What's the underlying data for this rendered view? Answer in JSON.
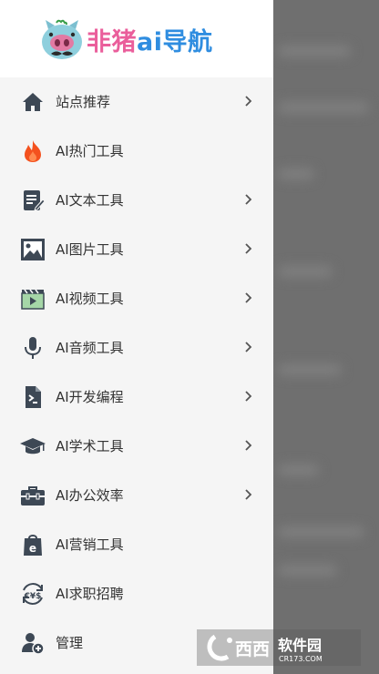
{
  "brand": {
    "pink_text": "非猪",
    "blue_text": "ai导航",
    "logo_icon": "pig-logo",
    "colors": {
      "pink": "#ea5e9b",
      "blue": "#2f8de0"
    }
  },
  "menu": {
    "items": [
      {
        "label": "站点推荐",
        "icon": "home-icon",
        "has_chevron": true
      },
      {
        "label": "AI热门工具",
        "icon": "flame-icon",
        "has_chevron": false
      },
      {
        "label": "AI文本工具",
        "icon": "document-edit-icon",
        "has_chevron": true
      },
      {
        "label": "AI图片工具",
        "icon": "image-icon",
        "has_chevron": true
      },
      {
        "label": "AI视频工具",
        "icon": "video-icon",
        "has_chevron": true
      },
      {
        "label": "AI音频工具",
        "icon": "microphone-icon",
        "has_chevron": true
      },
      {
        "label": "AI开发编程",
        "icon": "code-file-icon",
        "has_chevron": true
      },
      {
        "label": "AI学术工具",
        "icon": "graduation-cap-icon",
        "has_chevron": true
      },
      {
        "label": "AI办公效率",
        "icon": "briefcase-icon",
        "has_chevron": true
      },
      {
        "label": "AI营销工具",
        "icon": "shopping-bag-icon",
        "has_chevron": false
      },
      {
        "label": "AI求职招聘",
        "icon": "currency-exchange-icon",
        "has_chevron": false
      },
      {
        "label": "管理",
        "icon": "user-add-icon",
        "has_chevron": false
      }
    ]
  },
  "watermark": {
    "brand_text": "西西",
    "sub_text": "软件园",
    "domain": "CR173.COM"
  }
}
